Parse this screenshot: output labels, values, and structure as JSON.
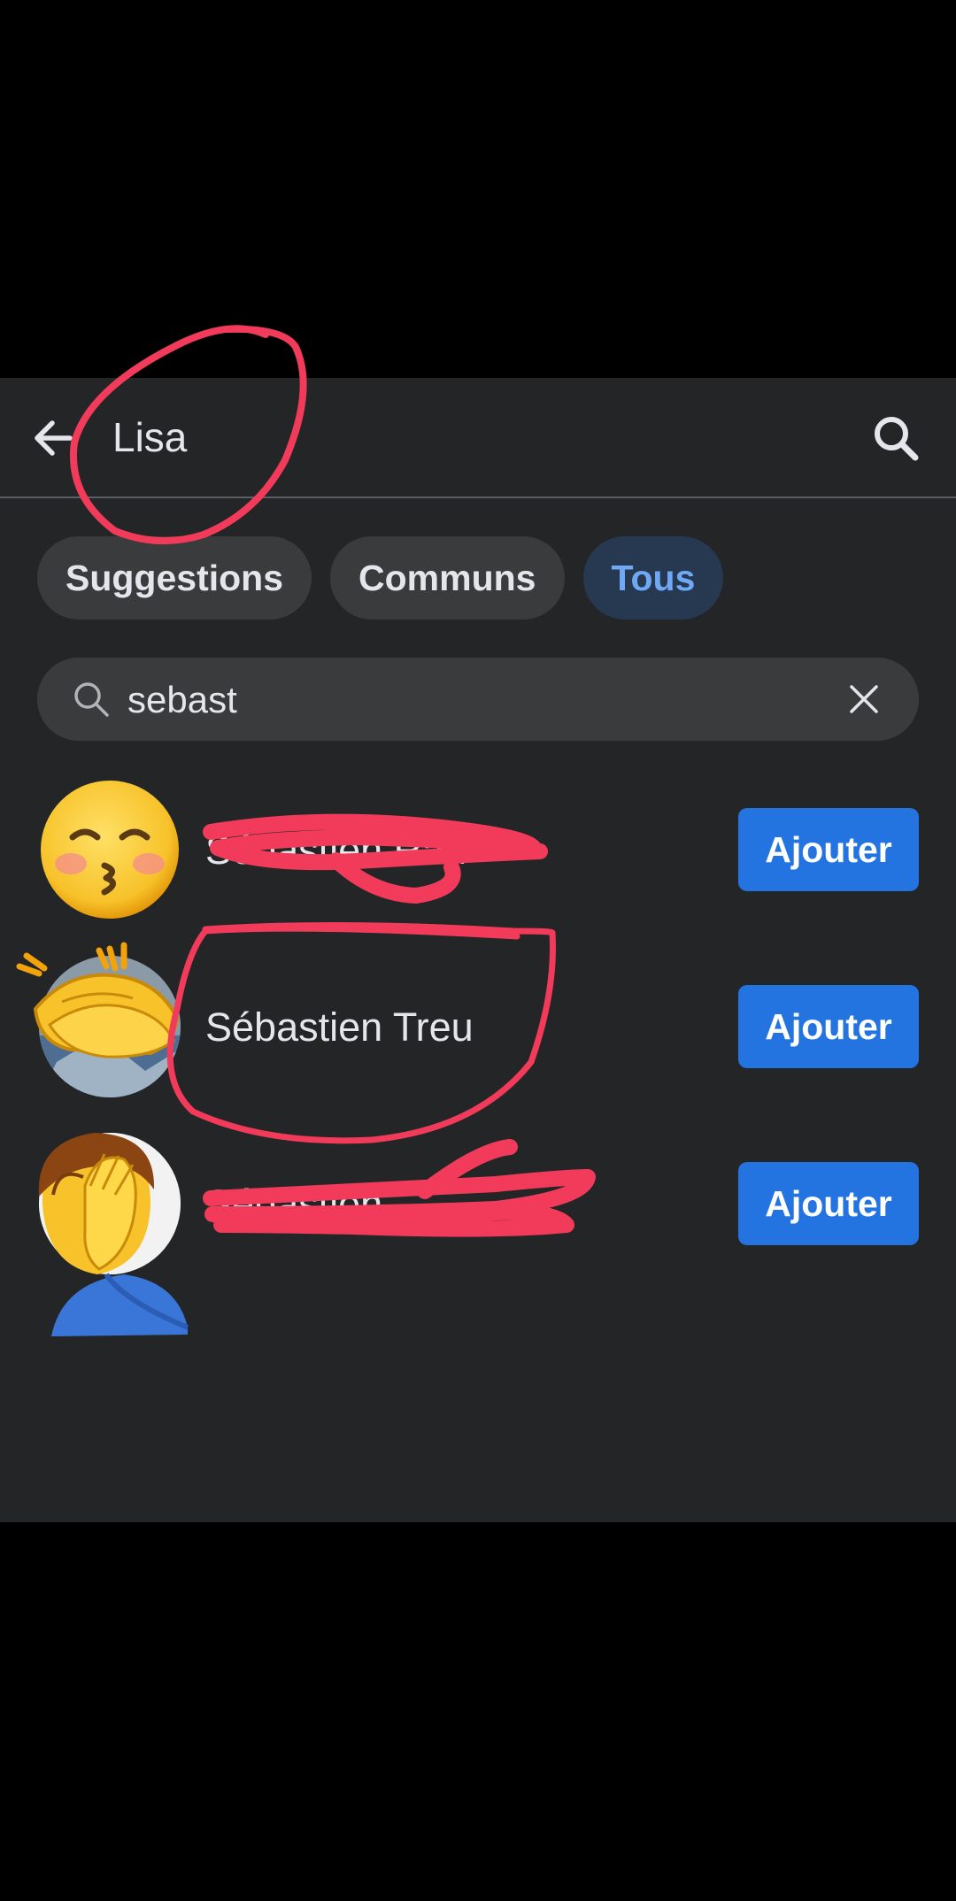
{
  "header": {
    "title": "Lisa",
    "back_icon": "arrow-left-icon",
    "search_icon": "search-icon"
  },
  "filters": [
    {
      "label": "Suggestions",
      "active": false
    },
    {
      "label": "Communs",
      "active": false
    },
    {
      "label": "Tous",
      "active": true
    }
  ],
  "search": {
    "value": "sebast",
    "icon": "search-icon",
    "clear_icon": "close-icon"
  },
  "results": [
    {
      "name": "Sébastien Rau",
      "avatar": "kissing-face-emoji",
      "button": "Ajouter",
      "redacted": true
    },
    {
      "name": "Sébastien Treu",
      "avatar": "photo-with-clapping-hands-emoji",
      "button": "Ajouter",
      "redacted": false
    },
    {
      "name": "Sébastien",
      "avatar": "facepalm-emoji",
      "button": "Ajouter",
      "redacted": true
    }
  ],
  "colors": {
    "background": "#242526",
    "accent": "#2374e1",
    "active_chip_text": "#6fa8f5",
    "annotation": "#f23b5a"
  }
}
